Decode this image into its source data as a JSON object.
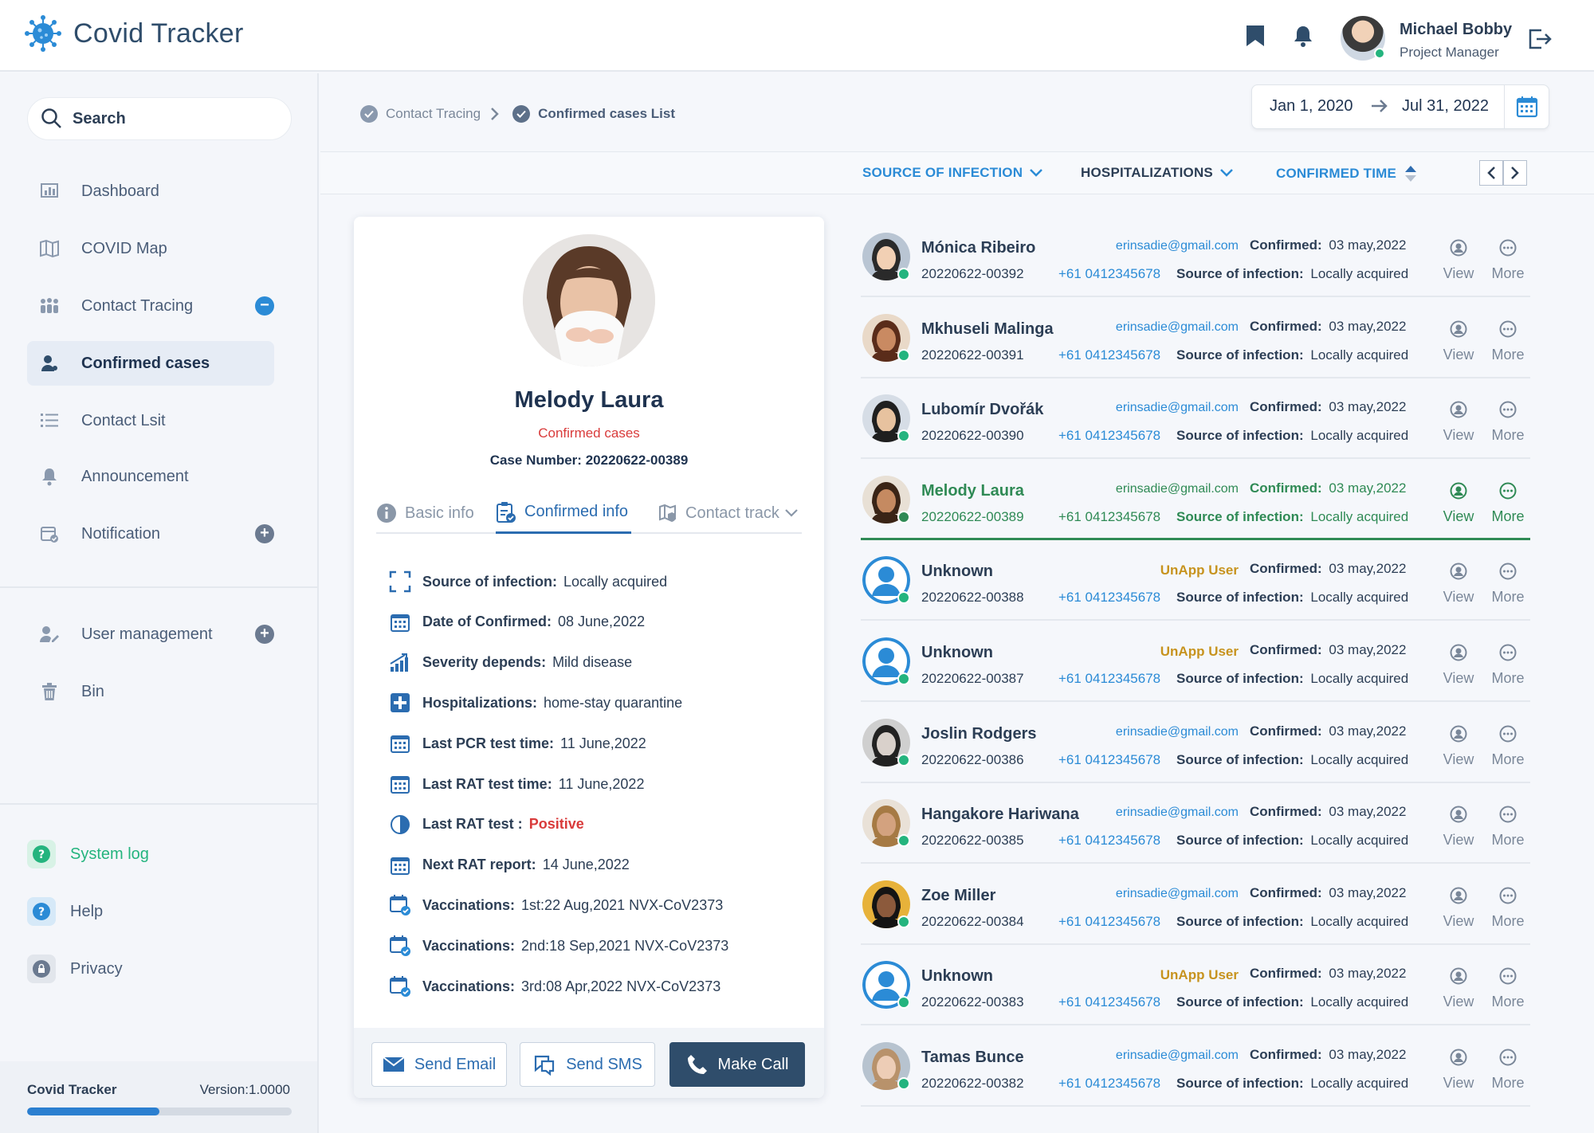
{
  "app": {
    "title": "Covid Tracker"
  },
  "user": {
    "name": "Michael Bobby",
    "role": "Project Manager"
  },
  "search": {
    "label": "Search"
  },
  "nav": [
    {
      "label": "Dashboard",
      "icon": "dashboard-icon"
    },
    {
      "label": "COVID Map",
      "icon": "map-icon"
    },
    {
      "label": "Contact Tracing",
      "icon": "people-icon",
      "badge": "−"
    },
    {
      "label": "Confirmed cases",
      "icon": "person-icon",
      "active": true
    },
    {
      "label": "Contact Lsit",
      "icon": "list-icon"
    },
    {
      "label": "Announcement",
      "icon": "bell-icon"
    },
    {
      "label": "Notification",
      "icon": "calendar-check-icon",
      "badge": "+"
    },
    {
      "label": "User management",
      "icon": "user-edit-icon",
      "badge": "+"
    },
    {
      "label": "Bin",
      "icon": "trash-icon"
    }
  ],
  "footer_nav": [
    {
      "label": "System log",
      "icon": "question-icon",
      "color": "#24b47e"
    },
    {
      "label": "Help",
      "icon": "question-icon",
      "color": "#2b8bd6"
    },
    {
      "label": "Privacy",
      "icon": "lock-icon",
      "color": "#6b7a90"
    }
  ],
  "version": {
    "name": "Covid Tracker",
    "label": "Version:1.0000",
    "progress": 0.5
  },
  "breadcrumb": [
    "Contact Tracing",
    "Confirmed cases List"
  ],
  "daterange": {
    "from": "Jan 1, 2020",
    "to": "Jul 31, 2022"
  },
  "filters": [
    "SOURCE OF INFECTION",
    "HOSPITALIZATIONS",
    "CONFIRMED TIME"
  ],
  "detail": {
    "name": "Melody Laura",
    "status": "Confirmed cases",
    "case_label": "Case Number:",
    "case_number": "20220622-00389",
    "tabs": [
      "Basic info",
      "Confirmed info",
      "Contact track"
    ],
    "rows": [
      {
        "label": "Source of infection:",
        "value": "Locally acquired",
        "icon": "scan-icon"
      },
      {
        "label": "Date of Confirmed:",
        "value": "08 June,2022",
        "icon": "calendar-icon"
      },
      {
        "label": "Severity depends:",
        "value": "Mild disease",
        "icon": "chart-icon"
      },
      {
        "label": "Hospitalizations:",
        "value": "home-stay quarantine",
        "icon": "hospital-icon"
      },
      {
        "label": "Last PCR test time:",
        "value": "11 June,2022",
        "icon": "calendar-icon"
      },
      {
        "label": "Last RAT test time:",
        "value": "11 June,2022",
        "icon": "calendar-icon"
      },
      {
        "label": "Last RAT test :",
        "value": "Positive",
        "icon": "half-circle-icon"
      },
      {
        "label": "Next RAT report:",
        "value": "14 June,2022",
        "icon": "calendar-icon"
      },
      {
        "label": "Vaccinations:",
        "value": "1st:22 Aug,2021  NVX-CoV2373",
        "icon": "calendar-check-icon"
      },
      {
        "label": "Vaccinations:",
        "value": "2nd:18 Sep,2021  NVX-CoV2373",
        "icon": "calendar-check-icon"
      },
      {
        "label": "Vaccinations:",
        "value": "3rd:08 Apr,2022  NVX-CoV2373",
        "icon": "calendar-check-icon"
      }
    ],
    "buttons": {
      "email": "Send Email",
      "sms": "Send SMS",
      "call": "Make Call"
    }
  },
  "list_labels": {
    "confirmed": "Confirmed:",
    "source": "Source of infection:",
    "view": "View",
    "more": "More"
  },
  "cases": [
    {
      "name": "Mónica Ribeiro",
      "id": "20220622-00392",
      "contact": "erinsadie@gmail.com",
      "phone": "+61 0412345678",
      "confirmed": "03 may,2022",
      "source": "Locally acquired"
    },
    {
      "name": "Mkhuseli Malinga",
      "id": "20220622-00391",
      "contact": "erinsadie@gmail.com",
      "phone": "+61 0412345678",
      "confirmed": "03 may,2022",
      "source": "Locally acquired"
    },
    {
      "name": "Lubomír Dvořák",
      "id": "20220622-00390",
      "contact": "erinsadie@gmail.com",
      "phone": "+61 0412345678",
      "confirmed": "03 may,2022",
      "source": "Locally acquired"
    },
    {
      "name": "Melody Laura",
      "id": "20220622-00389",
      "contact": "erinsadie@gmail.com",
      "phone": "+61 0412345678",
      "confirmed": "03 may,2022",
      "source": "Locally acquired",
      "selected": true
    },
    {
      "name": "Unknown",
      "id": "20220622-00388",
      "contact": "UnApp User",
      "phone": "+61 0412345678",
      "confirmed": "03 may,2022",
      "source": "Locally acquired",
      "unapp": true
    },
    {
      "name": "Unknown",
      "id": "20220622-00387",
      "contact": "UnApp User",
      "phone": "+61 0412345678",
      "confirmed": "03 may,2022",
      "source": "Locally acquired",
      "unapp": true
    },
    {
      "name": "Joslin Rodgers",
      "id": "20220622-00386",
      "contact": "erinsadie@gmail.com",
      "phone": "+61 0412345678",
      "confirmed": "03 may,2022",
      "source": "Locally acquired"
    },
    {
      "name": "Hangakore Hariwana",
      "id": "20220622-00385",
      "contact": "erinsadie@gmail.com",
      "phone": "+61 0412345678",
      "confirmed": "03 may,2022",
      "source": "Locally acquired"
    },
    {
      "name": "Zoe Miller",
      "id": "20220622-00384",
      "contact": "erinsadie@gmail.com",
      "phone": "+61 0412345678",
      "confirmed": "03 may,2022",
      "source": "Locally acquired"
    },
    {
      "name": "Unknown",
      "id": "20220622-00383",
      "contact": "UnApp User",
      "phone": "+61 0412345678",
      "confirmed": "03 may,2022",
      "source": "Locally acquired",
      "unapp": true
    },
    {
      "name": "Tamas Bunce",
      "id": "20220622-00382",
      "contact": "erinsadie@gmail.com",
      "phone": "+61 0412345678",
      "confirmed": "03 may,2022",
      "source": "Locally acquired"
    }
  ],
  "colors": {
    "accent": "#2b6cb0",
    "brand_dark": "#2f4d6b",
    "selected": "#2f8a55",
    "positive": "#d93b3b",
    "unapp": "#c7931e"
  }
}
